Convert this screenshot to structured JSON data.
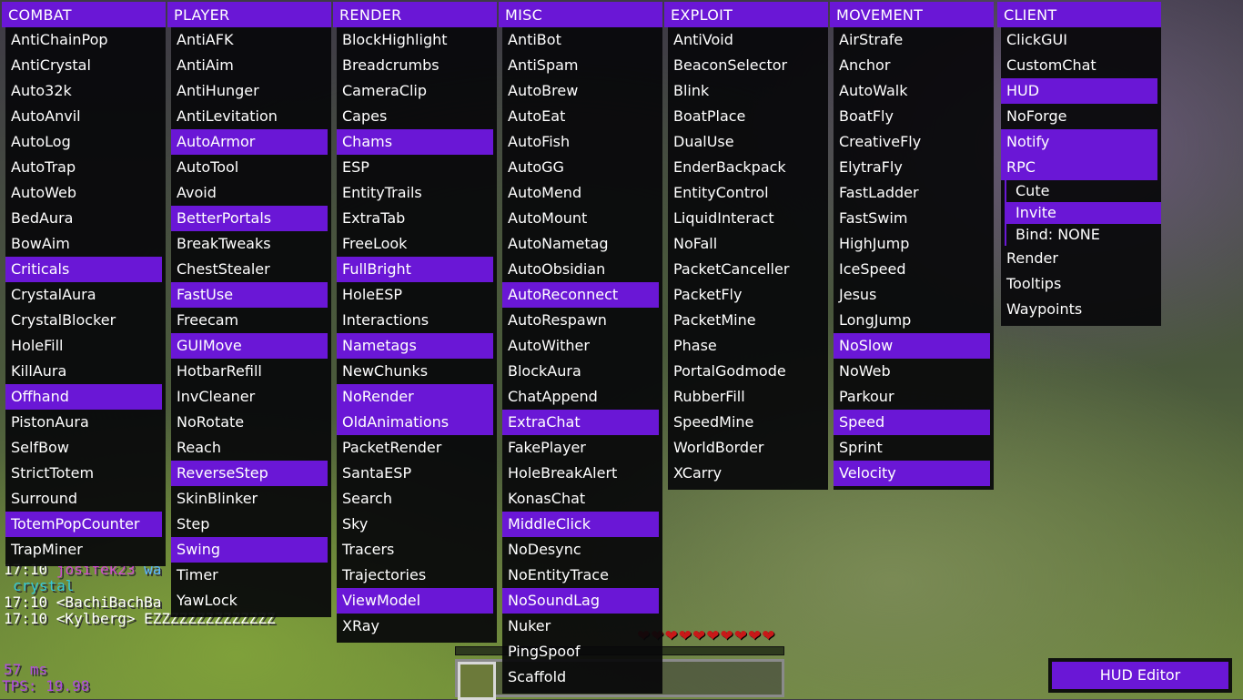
{
  "columns": [
    {
      "title": "COMBAT",
      "items": [
        {
          "label": "AntiChainPop",
          "on": false
        },
        {
          "label": "AntiCrystal",
          "on": false
        },
        {
          "label": "Auto32k",
          "on": false
        },
        {
          "label": "AutoAnvil",
          "on": false
        },
        {
          "label": "AutoLog",
          "on": false
        },
        {
          "label": "AutoTrap",
          "on": false
        },
        {
          "label": "AutoWeb",
          "on": false
        },
        {
          "label": "BedAura",
          "on": false
        },
        {
          "label": "BowAim",
          "on": false
        },
        {
          "label": "Criticals",
          "on": true
        },
        {
          "label": "CrystalAura",
          "on": false
        },
        {
          "label": "CrystalBlocker",
          "on": false
        },
        {
          "label": "HoleFill",
          "on": false
        },
        {
          "label": "KillAura",
          "on": false
        },
        {
          "label": "Offhand",
          "on": true
        },
        {
          "label": "PistonAura",
          "on": false
        },
        {
          "label": "SelfBow",
          "on": false
        },
        {
          "label": "StrictTotem",
          "on": false
        },
        {
          "label": "Surround",
          "on": false
        },
        {
          "label": "TotemPopCounter",
          "on": true
        },
        {
          "label": "TrapMiner",
          "on": false
        }
      ]
    },
    {
      "title": "PLAYER",
      "items": [
        {
          "label": "AntiAFK",
          "on": false
        },
        {
          "label": "AntiAim",
          "on": false
        },
        {
          "label": "AntiHunger",
          "on": false
        },
        {
          "label": "AntiLevitation",
          "on": false
        },
        {
          "label": "AutoArmor",
          "on": true
        },
        {
          "label": "AutoTool",
          "on": false
        },
        {
          "label": "Avoid",
          "on": false
        },
        {
          "label": "BetterPortals",
          "on": true
        },
        {
          "label": "BreakTweaks",
          "on": false
        },
        {
          "label": "ChestStealer",
          "on": false
        },
        {
          "label": "FastUse",
          "on": true
        },
        {
          "label": "Freecam",
          "on": false
        },
        {
          "label": "GUIMove",
          "on": true
        },
        {
          "label": "HotbarRefill",
          "on": false
        },
        {
          "label": "InvCleaner",
          "on": false
        },
        {
          "label": "NoRotate",
          "on": false
        },
        {
          "label": "Reach",
          "on": false
        },
        {
          "label": "ReverseStep",
          "on": true
        },
        {
          "label": "SkinBlinker",
          "on": false
        },
        {
          "label": "Step",
          "on": false
        },
        {
          "label": "Swing",
          "on": true
        },
        {
          "label": "Timer",
          "on": false
        },
        {
          "label": "YawLock",
          "on": false
        }
      ]
    },
    {
      "title": "RENDER",
      "items": [
        {
          "label": "BlockHighlight",
          "on": false
        },
        {
          "label": "Breadcrumbs",
          "on": false
        },
        {
          "label": "CameraClip",
          "on": false
        },
        {
          "label": "Capes",
          "on": false
        },
        {
          "label": "Chams",
          "on": true
        },
        {
          "label": "ESP",
          "on": false
        },
        {
          "label": "EntityTrails",
          "on": false
        },
        {
          "label": "ExtraTab",
          "on": false
        },
        {
          "label": "FreeLook",
          "on": false
        },
        {
          "label": "FullBright",
          "on": true
        },
        {
          "label": "HoleESP",
          "on": false
        },
        {
          "label": "Interactions",
          "on": false
        },
        {
          "label": "Nametags",
          "on": true
        },
        {
          "label": "NewChunks",
          "on": false
        },
        {
          "label": "NoRender",
          "on": true
        },
        {
          "label": "OldAnimations",
          "on": true
        },
        {
          "label": "PacketRender",
          "on": false
        },
        {
          "label": "SantaESP",
          "on": false
        },
        {
          "label": "Search",
          "on": false
        },
        {
          "label": "Sky",
          "on": false
        },
        {
          "label": "Tracers",
          "on": false
        },
        {
          "label": "Trajectories",
          "on": false
        },
        {
          "label": "ViewModel",
          "on": true
        },
        {
          "label": "XRay",
          "on": false
        }
      ]
    },
    {
      "title": "MISC",
      "items": [
        {
          "label": "AntiBot",
          "on": false
        },
        {
          "label": "AntiSpam",
          "on": false
        },
        {
          "label": "AutoBrew",
          "on": false
        },
        {
          "label": "AutoEat",
          "on": false
        },
        {
          "label": "AutoFish",
          "on": false
        },
        {
          "label": "AutoGG",
          "on": false
        },
        {
          "label": "AutoMend",
          "on": false
        },
        {
          "label": "AutoMount",
          "on": false
        },
        {
          "label": "AutoNametag",
          "on": false
        },
        {
          "label": "AutoObsidian",
          "on": false
        },
        {
          "label": "AutoReconnect",
          "on": true
        },
        {
          "label": "AutoRespawn",
          "on": false
        },
        {
          "label": "AutoWither",
          "on": false
        },
        {
          "label": "BlockAura",
          "on": false
        },
        {
          "label": "ChatAppend",
          "on": false
        },
        {
          "label": "ExtraChat",
          "on": true
        },
        {
          "label": "FakePlayer",
          "on": false
        },
        {
          "label": "HoleBreakAlert",
          "on": false
        },
        {
          "label": "KonasChat",
          "on": false
        },
        {
          "label": "MiddleClick",
          "on": true
        },
        {
          "label": "NoDesync",
          "on": false
        },
        {
          "label": "NoEntityTrace",
          "on": false
        },
        {
          "label": "NoSoundLag",
          "on": true
        },
        {
          "label": "Nuker",
          "on": false
        },
        {
          "label": "PingSpoof",
          "on": false
        },
        {
          "label": "Scaffold",
          "on": false
        }
      ]
    },
    {
      "title": "EXPLOIT",
      "items": [
        {
          "label": "AntiVoid",
          "on": false
        },
        {
          "label": "BeaconSelector",
          "on": false
        },
        {
          "label": "Blink",
          "on": false
        },
        {
          "label": "BoatPlace",
          "on": false
        },
        {
          "label": "DualUse",
          "on": false
        },
        {
          "label": "EnderBackpack",
          "on": false
        },
        {
          "label": "EntityControl",
          "on": false
        },
        {
          "label": "LiquidInteract",
          "on": false
        },
        {
          "label": "NoFall",
          "on": false
        },
        {
          "label": "PacketCanceller",
          "on": false
        },
        {
          "label": "PacketFly",
          "on": false
        },
        {
          "label": "PacketMine",
          "on": false
        },
        {
          "label": "Phase",
          "on": false
        },
        {
          "label": "PortalGodmode",
          "on": false
        },
        {
          "label": "RubberFill",
          "on": false
        },
        {
          "label": "SpeedMine",
          "on": false
        },
        {
          "label": "WorldBorder",
          "on": false
        },
        {
          "label": "XCarry",
          "on": false
        }
      ]
    },
    {
      "title": "MOVEMENT",
      "items": [
        {
          "label": "AirStrafe",
          "on": false
        },
        {
          "label": "Anchor",
          "on": false
        },
        {
          "label": "AutoWalk",
          "on": false
        },
        {
          "label": "BoatFly",
          "on": false
        },
        {
          "label": "CreativeFly",
          "on": false
        },
        {
          "label": "ElytraFly",
          "on": false
        },
        {
          "label": "FastLadder",
          "on": false
        },
        {
          "label": "FastSwim",
          "on": false
        },
        {
          "label": "HighJump",
          "on": false
        },
        {
          "label": "IceSpeed",
          "on": false
        },
        {
          "label": "Jesus",
          "on": false
        },
        {
          "label": "LongJump",
          "on": false
        },
        {
          "label": "NoSlow",
          "on": true
        },
        {
          "label": "NoWeb",
          "on": false
        },
        {
          "label": "Parkour",
          "on": false
        },
        {
          "label": "Speed",
          "on": true
        },
        {
          "label": "Sprint",
          "on": false
        },
        {
          "label": "Velocity",
          "on": true
        }
      ]
    },
    {
      "title": "CLIENT",
      "items": [
        {
          "label": "ClickGUI",
          "on": false
        },
        {
          "label": "CustomChat",
          "on": false
        },
        {
          "label": "HUD",
          "on": true
        },
        {
          "label": "NoForge",
          "on": false
        },
        {
          "label": "Notify",
          "on": true
        },
        {
          "label": "RPC",
          "on": true
        },
        {
          "label": "Cute",
          "on": false,
          "sub": true
        },
        {
          "label": "Invite",
          "on": true,
          "sub": true
        },
        {
          "label": "Bind: NONE",
          "on": false,
          "sub": true
        },
        {
          "label": "Render",
          "on": false
        },
        {
          "label": "Tooltips",
          "on": false
        },
        {
          "label": "Waypoints",
          "on": false
        }
      ]
    }
  ],
  "chat": {
    "line1_time": "17:10",
    "line1_name": "josifek23",
    "line1_rest": "wa",
    "line2": "crystal",
    "line3": "17:10 <BachiBachBa",
    "line4": "17:10 <Kylberg> EZZZZZZZZZZZZZZ"
  },
  "hud": {
    "ping": "57 ms",
    "tps": "TPS: 19.98",
    "hearts": "❤❤❤❤❤❤❤❤❤❤",
    "hud_editor_label": "HUD Editor"
  }
}
